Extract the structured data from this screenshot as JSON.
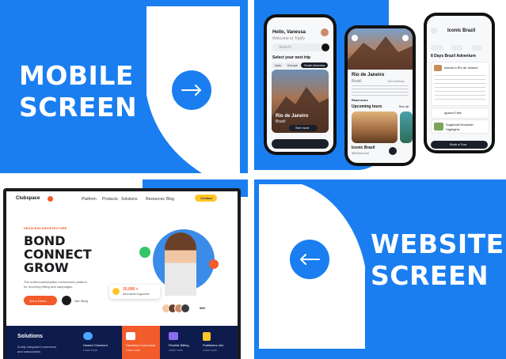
{
  "mobile_label": {
    "line1": "MOBILE",
    "line2": "SCREEN"
  },
  "website_label": {
    "line1": "WEBSITE",
    "line2": "SCREEN"
  },
  "phone1": {
    "greeting": "Hello, Vanessa",
    "subtitle": "Welcome to Tripify",
    "search_placeholder": "Search",
    "section_title": "Select your next trip",
    "tabs": [
      "Asia",
      "Europe",
      "South America"
    ],
    "card_title": "Rio de Janeiro",
    "card_sub": "Brazil",
    "card_button": "See more"
  },
  "phone2": {
    "title": "Rio de Janeiro",
    "country": "Brazil",
    "reviews": "143 reviews",
    "read_more": "Read more",
    "section": "Upcoming tours",
    "see_all": "See all",
    "tour_title": "Iconic Brazil",
    "tour_meta": "$659/person"
  },
  "phone3": {
    "title": "Iconic Brazil",
    "day_label": "8 Days Brazil Adventure",
    "item1": "Arrival in Rio de Janeiro",
    "item2": "Iguazu Falls",
    "item3": "Sugarloaf Mountain",
    "item4": "Highlights",
    "button": "Book a Tour"
  },
  "website": {
    "brand": "Clubspace",
    "nav": [
      "Platform",
      "Products",
      "Solutions",
      "Resources",
      "Blog"
    ],
    "cta": "Contact",
    "eyebrow": "HEADLESS ARCHITECTURE",
    "headline": [
      "BOND",
      "CONNECT",
      "GROW"
    ],
    "description_line1": "The unified subscription ecommerce platform",
    "description_line2": "for recurring billing and campaigns.",
    "primary_button": "Get a Demo",
    "secondary_button": "Our Story",
    "stat_value": "10,000 +",
    "stat_label": "Merchants Supported",
    "avatar_count": "5M+",
    "solutions_title": "Solutions",
    "solutions_desc_line1": "A fully integrated commerce",
    "solutions_desc_line2": "and subscription.",
    "solutions_items": [
      "Hosted Checkout",
      "Headless Commerce",
      "Flexible Billing",
      "Publishers Info"
    ],
    "learn_more": "Learn more"
  },
  "colors": {
    "brand_blue": "#1a7ef0",
    "orange": "#f25b2a",
    "yellow": "#ffc529",
    "navy": "#0e1b4d"
  },
  "icons": {
    "right_arrow": "arrow-right-icon",
    "left_arrow": "arrow-left-icon"
  }
}
